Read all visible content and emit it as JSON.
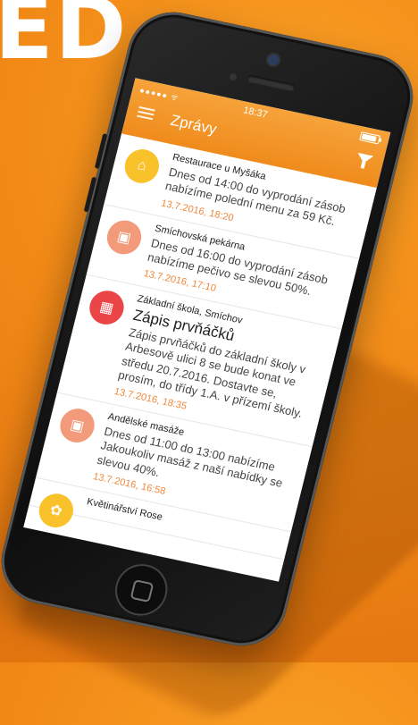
{
  "brand_fragment": "ED",
  "status": {
    "signal": "●●●●● ᯤ",
    "time": "18:37",
    "battery_level": 0.9
  },
  "header": {
    "title": "Zprávy"
  },
  "messages": [
    {
      "sender": "Restaurace u Myšáka",
      "headline": "",
      "body": "Dnes od 14:00 do vyprodání zásob\nnabízíme polední menu za 59 Kč.",
      "date": "13.7.2016, 18:20",
      "icon": "home-icon",
      "color": "#f9c22b"
    },
    {
      "sender": "Smíchovská pekárna",
      "headline": "",
      "body": "Dnes od 16:00 do vyprodání zásob\nnabízíme pečivo  se slevou 50%.",
      "date": "13.7.2016, 17:10",
      "icon": "briefcase-icon",
      "color": "#f29a79"
    },
    {
      "sender": "Základní škola, Smíchov",
      "headline": "Zápis prvňáčků",
      "body": "Zápis prvňáčků do základní školy v\nArbesově ulici 8 se bude konat ve\nstředu 20.7.2016. Dostavte se,\nprosím, do třídy 1.A. v přízemí školy.",
      "date": "13.7.2016, 18:35",
      "icon": "building-icon",
      "color": "#ea4648"
    },
    {
      "sender": "Andělské masáže",
      "headline": "",
      "body": "Dnes od 11:00 do 13:00 nabízíme\nJakoukoliv masáž z naší nabídky se\nslevou 40%.",
      "date": "13.7.2016, 16:58",
      "icon": "briefcase-icon",
      "color": "#f29a79"
    },
    {
      "sender": "Květinářství Rose",
      "headline": "",
      "body": "",
      "date": "",
      "icon": "flower-icon",
      "color": "#f9c22b"
    }
  ]
}
